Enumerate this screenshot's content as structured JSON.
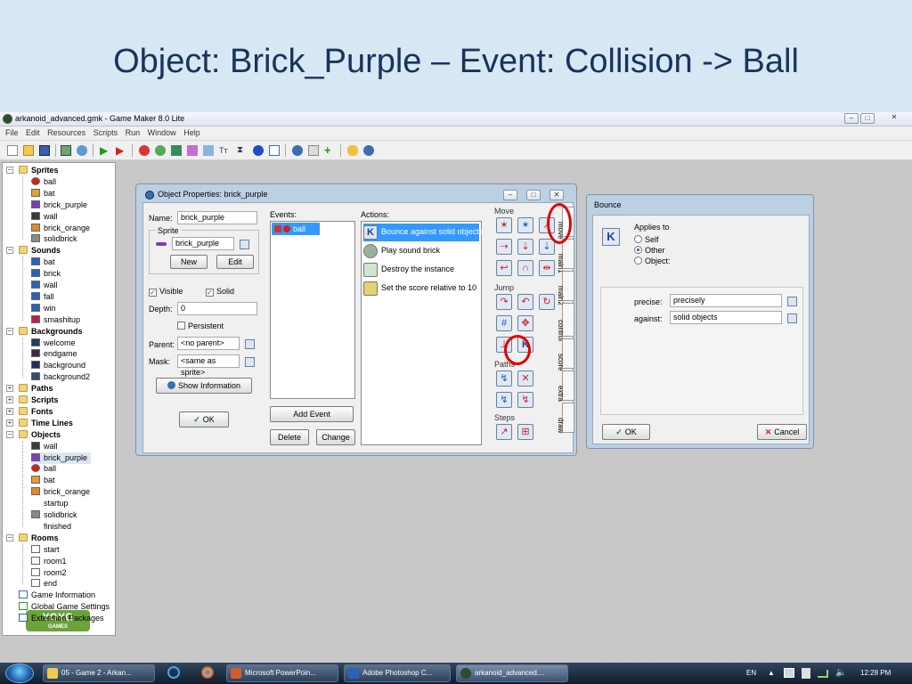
{
  "slide": {
    "title": "Object: Brick_Purple – Event: Collision -> Ball"
  },
  "window": {
    "title": "arkanoid_advanced.gmk - Game Maker 8.0 Lite",
    "menu": [
      "File",
      "Edit",
      "Resources",
      "Scripts",
      "Run",
      "Window",
      "Help"
    ]
  },
  "tree": {
    "groups": [
      {
        "label": "Sprites",
        "items": [
          "ball",
          "bat",
          "brick_purple",
          "wall",
          "brick_orange",
          "solidbrick"
        ]
      },
      {
        "label": "Sounds",
        "items": [
          "bat",
          "brick",
          "wall",
          "fall",
          "win",
          "smashitup"
        ]
      },
      {
        "label": "Backgrounds",
        "items": [
          "welcome",
          "endgame",
          "background",
          "background2"
        ]
      },
      {
        "label": "Paths",
        "items": []
      },
      {
        "label": "Scripts",
        "items": []
      },
      {
        "label": "Fonts",
        "items": []
      },
      {
        "label": "Time Lines",
        "items": []
      },
      {
        "label": "Objects",
        "items": [
          "wall",
          "brick_purple",
          "ball",
          "bat",
          "brick_orange",
          "startup",
          "solidbrick",
          "finished"
        ]
      },
      {
        "label": "Rooms",
        "items": [
          "start",
          "room1",
          "room2",
          "end"
        ]
      }
    ],
    "extras": [
      "Game Information",
      "Global Game Settings",
      "Extension Packages"
    ],
    "logo": "YOYO",
    "logo_sub": "GAMES"
  },
  "object_props": {
    "title": "Object Properties: brick_purple",
    "name_label": "Name:",
    "name_value": "brick_purple",
    "sprite_label": "Sprite",
    "sprite_value": "brick_purple",
    "new_button": "New",
    "edit_button": "Edit",
    "visible_label": "Visible",
    "solid_label": "Solid",
    "depth_label": "Depth:",
    "depth_value": "0",
    "persistent_label": "Persistent",
    "parent_label": "Parent:",
    "parent_value": "<no parent>",
    "mask_label": "Mask:",
    "mask_value": "<same as sprite>",
    "show_info_button": "Show Information",
    "ok_button": "OK",
    "events_label": "Events:",
    "events": [
      "ball"
    ],
    "actions_label": "Actions:",
    "actions": [
      "Bounce against solid objects",
      "Play sound brick",
      "Destroy the instance",
      "Set the score relative to 10"
    ],
    "add_event_button": "Add Event",
    "delete_button": "Delete",
    "change_button": "Change",
    "palette_groups": [
      "Move",
      "Jump",
      "Paths",
      "Steps"
    ],
    "tabs": [
      "move",
      "main1",
      "main2",
      "control",
      "score",
      "extra",
      "draw"
    ]
  },
  "bounce": {
    "title": "Bounce",
    "applies_to_label": "Applies to",
    "applies_options": [
      "Self",
      "Other",
      "Object:"
    ],
    "precise_label": "precise:",
    "precise_value": "precisely",
    "against_label": "against:",
    "against_value": "solid objects",
    "ok_button": "OK",
    "cancel_button": "Cancel"
  },
  "taskbar": {
    "tasks": [
      "05 - Game 2 - Arkan...",
      "Microsoft PowerPoin...",
      "Adobe Photoshop C...",
      "arkanoid_advanced...."
    ],
    "lang": "EN",
    "clock": "12:28 PM"
  },
  "colors": {
    "slide_title": "#17345a",
    "selection": "#3399ff",
    "annotation": "#e00000"
  }
}
